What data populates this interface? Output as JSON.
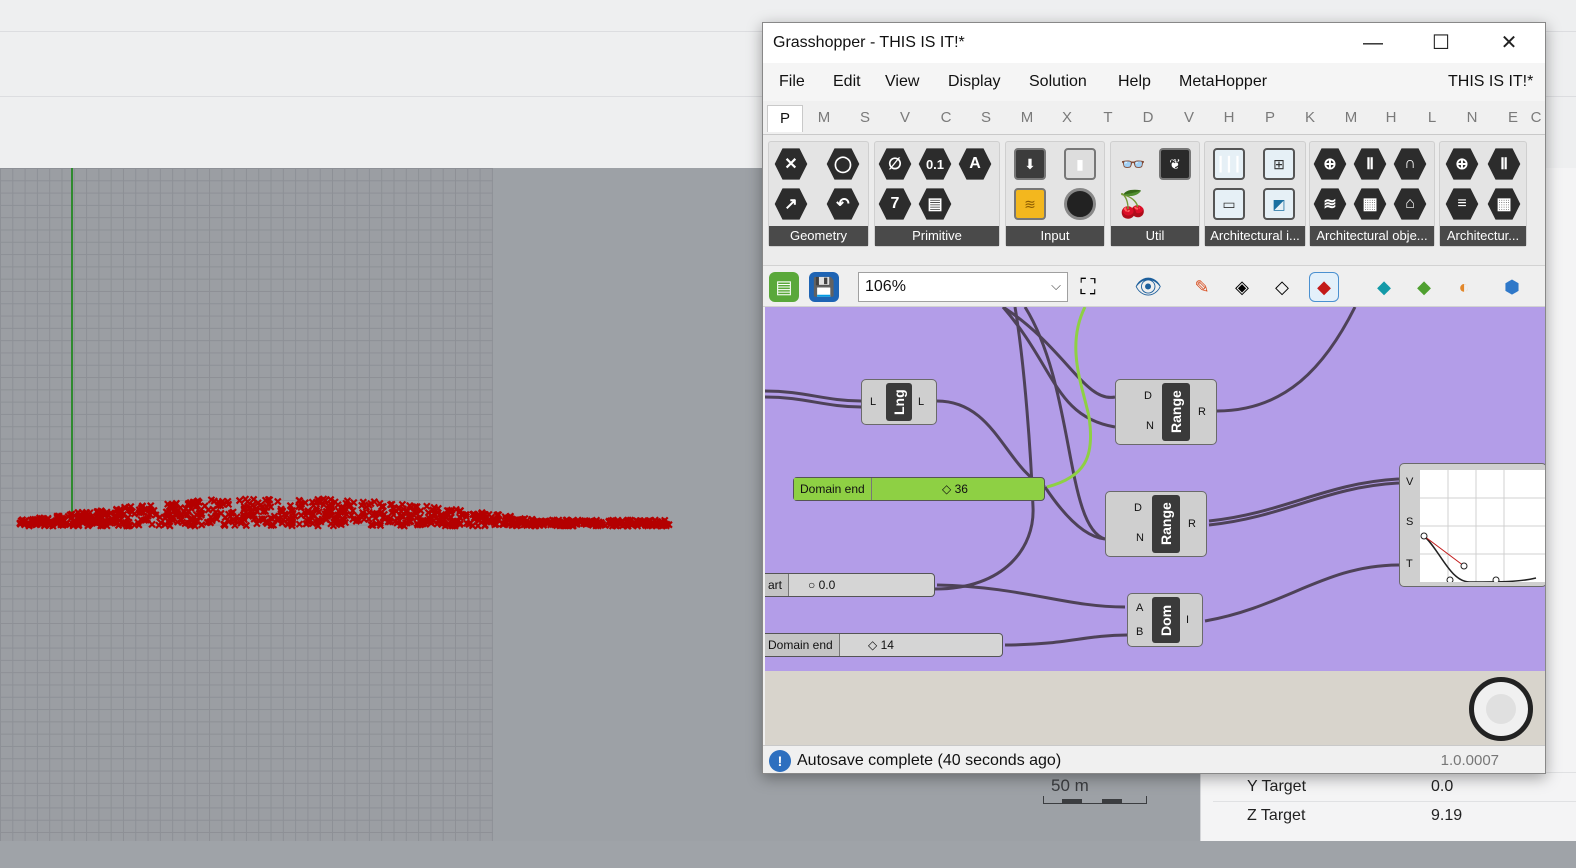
{
  "rhino": {
    "scale_label": "50 m",
    "properties": [
      {
        "key": "Y Target",
        "value": "0.0"
      },
      {
        "key": "Z Target",
        "value": "9.19"
      }
    ]
  },
  "gh": {
    "title": "Grasshopper - THIS IS IT!*",
    "window_buttons": {
      "minimize": "—",
      "maximize": "☐",
      "close": "✕"
    },
    "menu": [
      "File",
      "Edit",
      "View",
      "Display",
      "Solution",
      "Help",
      "MetaHopper"
    ],
    "doc_name": "THIS IS IT!*",
    "tabs": [
      "P",
      "M",
      "S",
      "V",
      "C",
      "S",
      "M",
      "X",
      "T",
      "D",
      "V",
      "H",
      "P",
      "K",
      "M",
      "H",
      "L",
      "N",
      "E",
      "C"
    ],
    "groups": [
      "Geometry",
      "Primitive",
      "Input",
      "Util",
      "Architectural i...",
      "Architectural obje...",
      "Architectur..."
    ],
    "geometry_icons": [
      "✕",
      "◯",
      "↗",
      "↶"
    ],
    "primitive_icons": [
      "∅",
      "0.1",
      "A",
      "7",
      "▤"
    ],
    "zoom": "106%",
    "canvas": {
      "lng_core": "Lng",
      "lng_inputs": [
        "L"
      ],
      "lng_outputs": [
        "L"
      ],
      "range_core": "Range",
      "range_inputs": [
        "D",
        "N"
      ],
      "range_outputs": [
        "R"
      ],
      "dom_core": "Dom",
      "dom_inputs": [
        "A",
        "B"
      ],
      "dom_outputs": [
        "I"
      ],
      "graph_inputs": [
        "V",
        "S",
        "T"
      ],
      "slider1_label": "Domain end",
      "slider1_value": "◇ 36",
      "slider2_label": "art",
      "slider2_value": "○ 0.0",
      "slider3_label": "Domain end",
      "slider3_value": "◇ 14"
    },
    "status_message": "Autosave complete (40 seconds ago)",
    "status_icon": "!",
    "version": "1.0.0007"
  },
  "colors": {
    "canvas": "#b39de8",
    "wire": "#4e4258",
    "green_wire": "#8ed044",
    "points": "#b40000",
    "axis": "#2f8a2f"
  }
}
